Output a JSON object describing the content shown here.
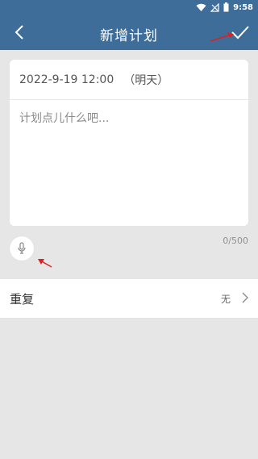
{
  "status_bar": {
    "time": "9:58"
  },
  "header": {
    "title": "新增计划"
  },
  "plan": {
    "date": "2022-9-19 12:00",
    "relative_day": "（明天）",
    "placeholder": "计划点儿什么吧...",
    "counter": "0/500"
  },
  "repeat": {
    "label": "重复",
    "value": "无"
  },
  "colors": {
    "header": "#3d6d98",
    "background": "#e6e6e6",
    "annotation": "#e02020"
  },
  "icons": [
    "wifi-icon",
    "signal-icon",
    "battery-icon",
    "back-chevron-icon",
    "checkmark-icon",
    "microphone-icon",
    "chevron-right-icon"
  ]
}
